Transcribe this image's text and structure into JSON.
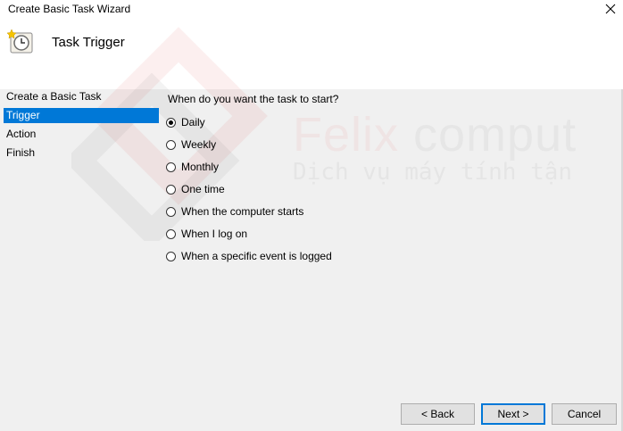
{
  "window": {
    "title": "Create Basic Task Wizard",
    "close_icon": "close-icon"
  },
  "header": {
    "title": "Task Trigger",
    "icon": "clock-icon"
  },
  "sidebar": {
    "items": [
      {
        "label": "Create a Basic Task",
        "active": false
      },
      {
        "label": "Trigger",
        "active": true
      },
      {
        "label": "Action",
        "active": false
      },
      {
        "label": "Finish",
        "active": false
      }
    ]
  },
  "trigger": {
    "question": "When do you want the task to start?",
    "options": [
      {
        "label": "Daily",
        "checked": true
      },
      {
        "label": "Weekly",
        "checked": false
      },
      {
        "label": "Monthly",
        "checked": false
      },
      {
        "label": "One time",
        "checked": false
      },
      {
        "label": "When the computer starts",
        "checked": false
      },
      {
        "label": "When I log on",
        "checked": false
      },
      {
        "label": "When a specific event is logged",
        "checked": false
      }
    ]
  },
  "watermark": {
    "brand_a": "Felix",
    "brand_b": " comput",
    "tagline": "Dịch vụ máy tính tận"
  },
  "buttons": {
    "back": "< Back",
    "next": "Next >",
    "cancel": "Cancel"
  },
  "colors": {
    "selection": "#0078d7",
    "default_button_border": "#0078d7"
  }
}
